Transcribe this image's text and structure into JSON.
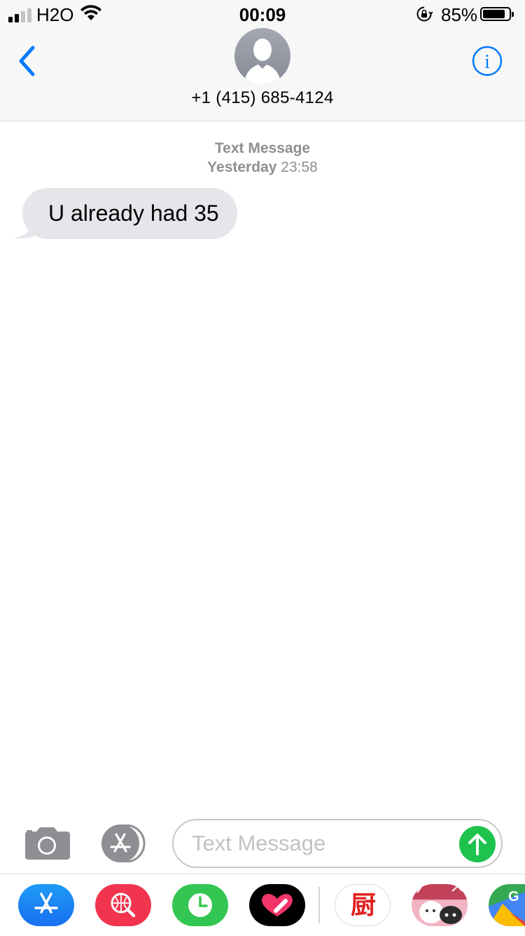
{
  "status_bar": {
    "carrier": "H2O",
    "time": "00:09",
    "battery_percent": "85%",
    "battery_level": 0.85,
    "signal_bars_filled": 2,
    "signal_bars_total": 4
  },
  "header": {
    "contact": "+1 (415) 685-4124",
    "back_icon": "chevron-left-icon",
    "info_icon": "info-icon"
  },
  "conversation": {
    "service": "Text Message",
    "date_label": "Yesterday",
    "time": "23:58",
    "messages": [
      {
        "direction": "incoming",
        "text": "U already had 35"
      }
    ]
  },
  "input_bar": {
    "placeholder": "Text Message",
    "value": "",
    "camera_icon": "camera-icon",
    "apps_icon": "app-store-icon",
    "send_icon": "send-arrow-icon"
  },
  "app_drawer": {
    "apps": [
      {
        "name": "App Store",
        "icon": "app-store-icon"
      },
      {
        "name": "Images",
        "icon": "globe-search-icon"
      },
      {
        "name": "Recents",
        "icon": "clock-icon"
      },
      {
        "name": "Digital Touch",
        "icon": "heart-icon"
      },
      {
        "name": "Kitchen",
        "icon": "kitchen-character-icon",
        "glyph": "厨"
      },
      {
        "name": "Sticker Pack",
        "icon": "sticker-pack-icon"
      },
      {
        "name": "Google Maps",
        "icon": "google-maps-icon"
      }
    ]
  },
  "colors": {
    "accent_blue": "#007aff",
    "send_green": "#1ec34d",
    "incoming_bubble": "#e5e5ea",
    "meta_gray": "#8e8e93"
  }
}
